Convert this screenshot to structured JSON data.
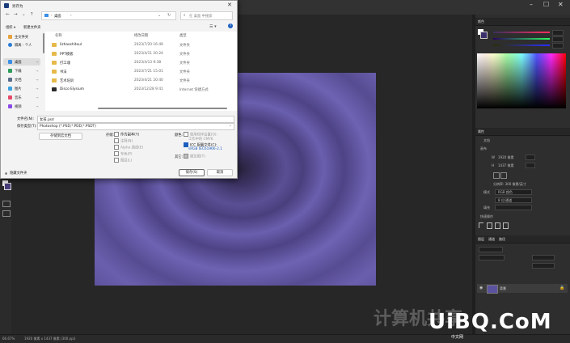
{
  "dialog": {
    "title": "另存为",
    "search_placeholder": "在 桌面 中搜索",
    "address": "桌面",
    "organize": "组织 ▾",
    "new_folder": "新建文件夹",
    "columns": {
      "name": "名称",
      "date": "修改日期",
      "type": "类型"
    },
    "sidebar": [
      {
        "label": "主文件夹",
        "color": "#e6a23c",
        "pin": ""
      },
      {
        "label": "隔离 - 个人",
        "color": "#2b7bd6",
        "pin": ""
      },
      {
        "label": "桌面",
        "color": "#3a8ee6",
        "pin": "📌"
      },
      {
        "label": "下载",
        "color": "#2e9c5b",
        "pin": "📌"
      },
      {
        "label": "文档",
        "color": "#5a6e8c",
        "pin": "📌"
      },
      {
        "label": "图片",
        "color": "#3aa3e0",
        "pin": "📌"
      },
      {
        "label": "音乐",
        "color": "#e64a6a",
        "pin": "📌"
      },
      {
        "label": "视频",
        "color": "#8a4ae6",
        "pin": "📌"
      }
    ],
    "files": [
      {
        "name": "lizhaoshitoul",
        "date": "2023/7/20 16:49",
        "type": "文件夹",
        "icon": "folder"
      },
      {
        "name": "PPT模板",
        "date": "2023/4/11 20:24",
        "type": "文件夹",
        "icon": "folder"
      },
      {
        "name": "打工魂",
        "date": "2023/4/13 9:38",
        "type": "文件夹",
        "icon": "folder"
      },
      {
        "name": "书法",
        "date": "2023/7/21 15:01",
        "type": "文件夹",
        "icon": "folder"
      },
      {
        "name": "艺术培训",
        "date": "2023/4/21 20:40",
        "type": "文件夹",
        "icon": "folder"
      },
      {
        "name": "Disco Elysium",
        "date": "2023/12/28 9:41",
        "type": "Internet 快捷方式",
        "icon": "shortcut"
      }
    ],
    "filename_label": "文件名(N):",
    "filename_value": "女孩.psd",
    "filetype_label": "保存类型(T):",
    "filetype_value": "Photoshop (*.PSD;*.PDD;*.PSDT)",
    "cloud_button": "存储到云文档",
    "save_section_label": "存储:",
    "save_options": [
      {
        "label": "作为副本(Y)",
        "checked": false,
        "dim": false
      },
      {
        "label": "注释(N)",
        "checked": false,
        "dim": true
      },
      {
        "label": "Alpha 通道(E)",
        "checked": false,
        "dim": true
      },
      {
        "label": "专色(P)",
        "checked": false,
        "dim": true
      },
      {
        "label": "图层(L)",
        "checked": false,
        "dim": true
      }
    ],
    "color_section_label": "颜色:",
    "color_options": [
      {
        "label": "使用校样设置(O):",
        "sub": "工作中的 CMYK",
        "checked": false,
        "dim": true
      },
      {
        "label": "ICC 配置文件(C):",
        "sub": "sRGB IEC61966-2.1",
        "checked": true,
        "dim": false
      }
    ],
    "other_label": "其它:",
    "thumbnail_label": "缩览图(T)",
    "hide_folders": "隐藏文件夹",
    "save_button": "保存(S)",
    "cancel_button": "取消"
  },
  "photoshop": {
    "status_zoom": "66.67%",
    "status_size": "1920 像素 x 1437 像素 (300 ppi)",
    "color_tab": "颜色",
    "properties_tab": "属性",
    "properties_doc": "文档",
    "canvas_label": "画布",
    "width_label": "W",
    "width_value": "1920 像素",
    "height_label": "H",
    "height_value": "1437 像素",
    "resolution": "分辨率: 300 像素/英寸",
    "mode_label": "模式",
    "mode_value": "RGB 颜色",
    "bits_value": "8 位/通道",
    "fill_label": "填充",
    "guides_label": "快速操作",
    "layers_tabs": [
      "图层",
      "通道",
      "路径"
    ],
    "layer_name": "背景",
    "accent_purple": "#6a5fae"
  },
  "watermark": {
    "text": "UiBQ.CoM",
    "sub": "中文网",
    "faint": "计算机共享"
  }
}
